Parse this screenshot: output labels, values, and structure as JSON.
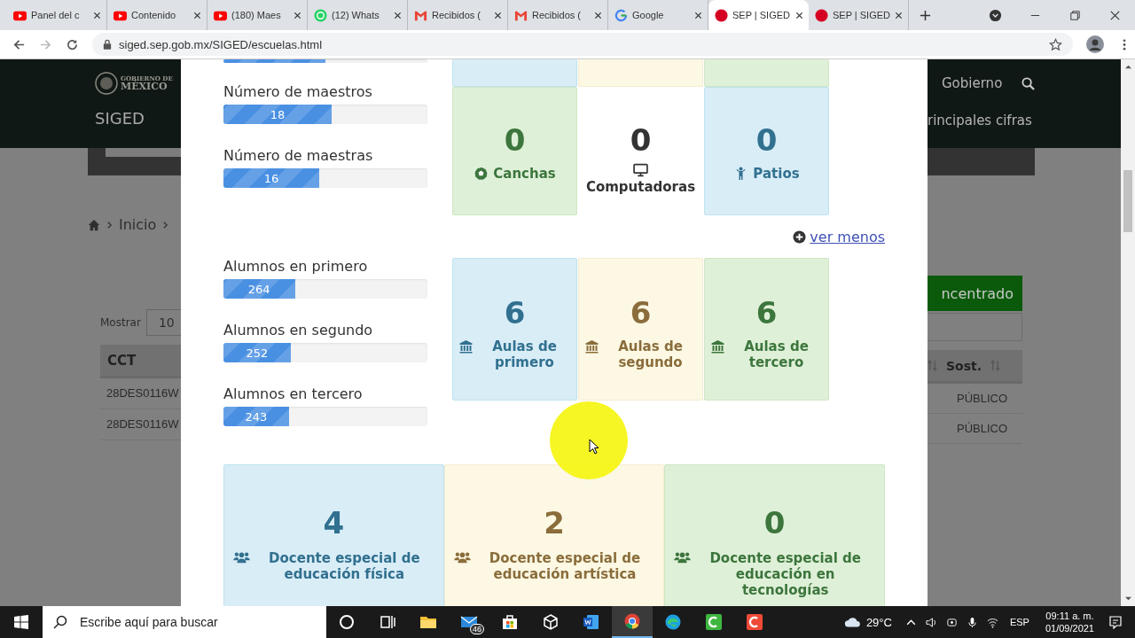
{
  "browser": {
    "tabs": [
      {
        "title": "Panel del c",
        "selected": false
      },
      {
        "title": "Contenido",
        "selected": false
      },
      {
        "title": "(180) Maes",
        "selected": false
      },
      {
        "title": "(12) Whats",
        "selected": false
      },
      {
        "title": "Recibidos (",
        "selected": false
      },
      {
        "title": "Recibidos (",
        "selected": false
      },
      {
        "title": "Google",
        "selected": false
      },
      {
        "title": "SEP | SIGED",
        "selected": true
      },
      {
        "title": "SEP | SIGED",
        "selected": false
      }
    ],
    "address": "siged.sep.gob.mx/SIGED/escuelas.html"
  },
  "background_page": {
    "logo_top": "GOBIERNO DE",
    "logo_bottom": "MÉXICO",
    "site": "SIGED",
    "nav": "Gobierno",
    "subnav": "rincipales cifras",
    "breadcrumb": "Inicio",
    "length_label": "Mostrar",
    "length_value": "10",
    "button": "ncentrado",
    "columns": [
      "CCT",
      "Sost."
    ],
    "rows": [
      [
        "28DES0116W",
        "PÚBLICO"
      ],
      [
        "28DES0116W",
        "PÚBLICO"
      ]
    ]
  },
  "modal": {
    "top_bar": {
      "level": 0.5
    },
    "top_cards": [
      {
        "kind": "info"
      },
      {
        "kind": "warning"
      },
      {
        "kind": "success"
      }
    ],
    "sections": [
      {
        "bars": [
          {
            "label": "Número de maestros",
            "value": "18",
            "level": 0.53
          },
          {
            "label": "Número de maestras",
            "value": "16",
            "level": 0.47
          }
        ],
        "cards": [
          {
            "kind": "success",
            "value": "0",
            "label": "Canchas"
          },
          {
            "kind": "plain",
            "value": "0",
            "label": "Computadoras"
          },
          {
            "kind": "info",
            "value": "0",
            "label": "Patios"
          }
        ]
      },
      {
        "bars": [
          {
            "label": "Alumnos en primero",
            "value": "264",
            "level": 0.35
          },
          {
            "label": "Alumnos en segundo",
            "value": "252",
            "level": 0.33
          },
          {
            "label": "Alumnos en tercero",
            "value": "243",
            "level": 0.32
          }
        ],
        "cards": [
          {
            "kind": "info",
            "value": "6",
            "label": "Aulas de primero"
          },
          {
            "kind": "warning",
            "value": "6",
            "label": "Aulas de segundo"
          },
          {
            "kind": "success",
            "value": "6",
            "label": "Aulas de tercero"
          }
        ]
      }
    ],
    "toggle": "ver menos",
    "bottom_cards": [
      {
        "kind": "info",
        "value": "4",
        "label": "Docente especial de educación física"
      },
      {
        "kind": "warning",
        "value": "2",
        "label": "Docente especial de educación artística"
      },
      {
        "kind": "success",
        "value": "0",
        "label": "Docente especial de educación en tecnologías"
      }
    ]
  },
  "taskbar": {
    "search_placeholder": "Escribe aquí para buscar",
    "apps": [
      {
        "active": false
      },
      {
        "active": false
      },
      {
        "active": false
      },
      {
        "active": false,
        "badge": "46"
      },
      {
        "active": false
      },
      {
        "active": false
      },
      {
        "active": false
      },
      {
        "active": true
      },
      {
        "active": false
      },
      {
        "active": false
      },
      {
        "active": false
      }
    ],
    "temperature": "29°C",
    "language": "ESP",
    "time": "09:11 a. m.",
    "date": "01/09/2021"
  }
}
